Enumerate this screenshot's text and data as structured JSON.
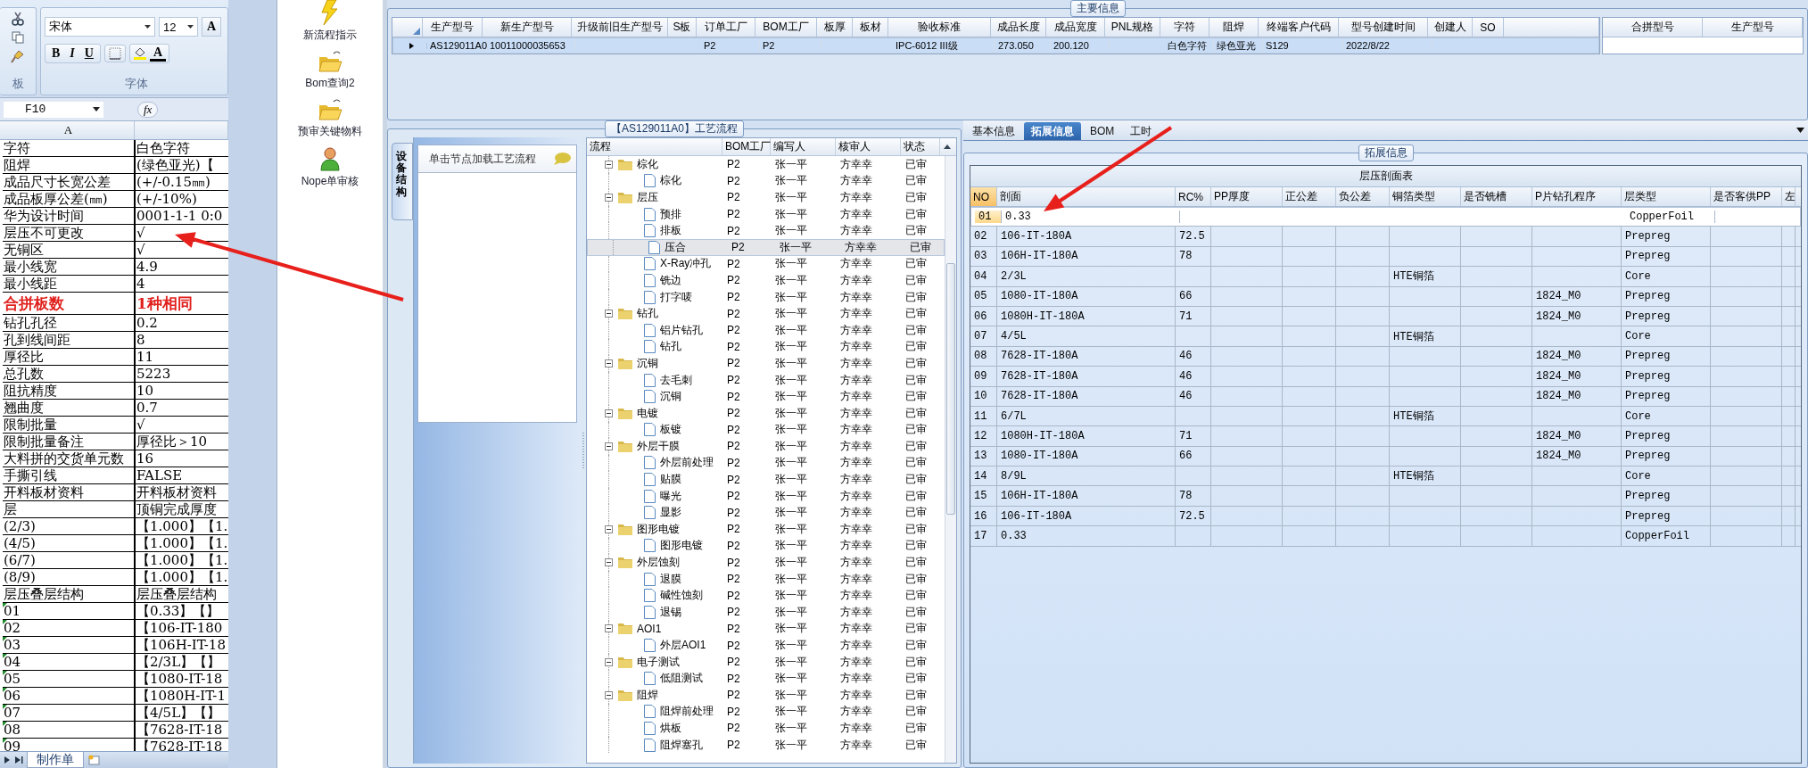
{
  "excel": {
    "clipboard_label": "板",
    "font_name": "宋体",
    "font_size": "12",
    "grow_font": "A",
    "format_buttons": [
      "B",
      "I",
      "U"
    ],
    "font_color": "A",
    "font_label": "字体",
    "name_box": "F10",
    "formula_label": "fx",
    "column_a": "A",
    "rows": [
      {
        "a": "字符",
        "b": "白色字符",
        "kind": "text"
      },
      {
        "a": "阻焊",
        "b": "(绿色亚光)【",
        "kind": "text"
      },
      {
        "a": "成品尺寸长宽公差",
        "b": "(+/-0.15㎜)",
        "kind": "text"
      },
      {
        "a": "成品板厚公差(㎜)",
        "b": "(+/-10%)",
        "kind": "text"
      },
      {
        "a": "华为设计时间",
        "b": "0001-1-1 0:0",
        "kind": "text"
      },
      {
        "a": "层压不可更改",
        "b": "√",
        "kind": "text"
      },
      {
        "a": "无铜区",
        "b": "√",
        "kind": "text"
      },
      {
        "a": "最小线宽",
        "b": "4.9",
        "kind": "text"
      },
      {
        "a": "最小线距",
        "b": "4",
        "kind": "text"
      },
      {
        "a": "合拼板数",
        "b": "1种相同",
        "kind": "highlight"
      },
      {
        "a": "钻孔孔径",
        "b": "0.2",
        "kind": "text"
      },
      {
        "a": "孔到线间距",
        "b": "8",
        "kind": "text"
      },
      {
        "a": "厚径比",
        "b": "11",
        "kind": "text"
      },
      {
        "a": "总孔数",
        "b": "5223",
        "kind": "text"
      },
      {
        "a": "阻抗精度",
        "b": "10",
        "kind": "text"
      },
      {
        "a": "翘曲度",
        "b": "0.7",
        "kind": "text"
      },
      {
        "a": "限制批量",
        "b": "√",
        "kind": "text"
      },
      {
        "a": "限制批量备注",
        "b": "厚径比＞10",
        "kind": "text"
      },
      {
        "a": "大料拼的交货单元数",
        "b": "16",
        "kind": "text"
      },
      {
        "a": "手撕引线",
        "b": "FALSE",
        "kind": "text"
      },
      {
        "a": "开料板材资料",
        "b": "开料板材资料",
        "kind": "text"
      },
      {
        "a": "层",
        "b": "顶铜完成厚度",
        "kind": "text"
      },
      {
        "a": "(2/3)",
        "b": "【1.000】【1.",
        "kind": "text"
      },
      {
        "a": "(4/5)",
        "b": "【1.000】【1.",
        "kind": "text"
      },
      {
        "a": "(6/7)",
        "b": "【1.000】【1.",
        "kind": "text"
      },
      {
        "a": "(8/9)",
        "b": "【1.000】【1.",
        "kind": "text"
      },
      {
        "a": "层压叠层结构",
        "b": "层压叠层结构",
        "kind": "text"
      },
      {
        "a": "01",
        "b": "【0.33】【】",
        "kind": "flagged"
      },
      {
        "a": "02",
        "b": "【106-IT-180",
        "kind": "flagged"
      },
      {
        "a": "03",
        "b": "【106H-IT-18",
        "kind": "flagged"
      },
      {
        "a": "04",
        "b": "【2/3L】【】",
        "kind": "flagged"
      },
      {
        "a": "05",
        "b": "【1080-IT-18",
        "kind": "flagged"
      },
      {
        "a": "06",
        "b": "【1080H-IT-1",
        "kind": "flagged"
      },
      {
        "a": "07",
        "b": "【4/5L】【】",
        "kind": "flagged"
      },
      {
        "a": "08",
        "b": "【7628-IT-18",
        "kind": "flagged"
      },
      {
        "a": "09",
        "b": "【7628-IT-18",
        "kind": "flagged"
      }
    ],
    "sheet_tab": "制作单"
  },
  "launcher": [
    "新流程指示",
    "Bom查询2",
    "预审关键物料",
    "Nope单审核"
  ],
  "main_info": {
    "title": "主要信息",
    "columns": [
      "生产型号",
      "新生产型号",
      "升级前旧生产型号",
      "S板",
      "订单工厂",
      "BOM工厂",
      "板厚",
      "板材",
      "验收标准",
      "成品长度",
      "成品宽度",
      "PNL规格",
      "字符",
      "阻焊",
      "终端客户代码",
      "型号创建时间",
      "创建人",
      "SO"
    ],
    "rows": [
      {
        "cells": [
          "AS129011A0",
          "10011000035653",
          null,
          null,
          "P2",
          "P2",
          null,
          null,
          "IPC-6012 III级",
          "273.050",
          "200.120",
          null,
          "白色字符",
          "绿色亚光",
          "S129",
          "2022/8/22",
          null,
          null
        ],
        "selected": true
      }
    ],
    "side_columns": [
      "合拼型号",
      "生产型号"
    ]
  },
  "process": {
    "title": "【AS129011A0】工艺流程",
    "side_tab": "设备结构",
    "hint": "单击节点加载工艺流程",
    "columns": [
      "流程",
      "BOM工厂",
      "编写人",
      "核审人",
      "状态"
    ],
    "tree": [
      {
        "name": "棕化",
        "bom": "P2",
        "writer": "张一平",
        "reviewer": "方幸幸",
        "status": "已审",
        "expanded": true,
        "selected": false,
        "children": [
          {
            "name": "棕化",
            "bom": "P2",
            "writer": "张一平",
            "reviewer": "方幸幸",
            "status": "已审",
            "selected": false
          }
        ]
      },
      {
        "name": "层压",
        "bom": "P2",
        "writer": "张一平",
        "reviewer": "方幸幸",
        "status": "已审",
        "expanded": true,
        "selected": false,
        "children": [
          {
            "name": "预排",
            "bom": "P2",
            "writer": "张一平",
            "reviewer": "方幸幸",
            "status": "已审",
            "selected": false
          },
          {
            "name": "排板",
            "bom": "P2",
            "writer": "张一平",
            "reviewer": "方幸幸",
            "status": "已审",
            "selected": false
          },
          {
            "name": "压合",
            "bom": "P2",
            "writer": "张一平",
            "reviewer": "方幸幸",
            "status": "已审",
            "selected": true
          },
          {
            "name": "X-Ray冲孔",
            "bom": "P2",
            "writer": "张一平",
            "reviewer": "方幸幸",
            "status": "已审",
            "selected": false
          },
          {
            "name": "铣边",
            "bom": "P2",
            "writer": "张一平",
            "reviewer": "方幸幸",
            "status": "已审",
            "selected": false
          },
          {
            "name": "打字唛",
            "bom": "P2",
            "writer": "张一平",
            "reviewer": "方幸幸",
            "status": "已审",
            "selected": false
          }
        ]
      },
      {
        "name": "钻孔",
        "bom": "P2",
        "writer": "张一平",
        "reviewer": "方幸幸",
        "status": "已审",
        "expanded": true,
        "selected": false,
        "children": [
          {
            "name": "铝片钻孔",
            "bom": "P2",
            "writer": "张一平",
            "reviewer": "方幸幸",
            "status": "已审",
            "selected": false
          },
          {
            "name": "钻孔",
            "bom": "P2",
            "writer": "张一平",
            "reviewer": "方幸幸",
            "status": "已审",
            "selected": false
          }
        ]
      },
      {
        "name": "沉铜",
        "bom": "P2",
        "writer": "张一平",
        "reviewer": "方幸幸",
        "status": "已审",
        "expanded": true,
        "selected": false,
        "children": [
          {
            "name": "去毛刺",
            "bom": "P2",
            "writer": "张一平",
            "reviewer": "方幸幸",
            "status": "已审",
            "selected": false
          },
          {
            "name": "沉铜",
            "bom": "P2",
            "writer": "张一平",
            "reviewer": "方幸幸",
            "status": "已审",
            "selected": false
          }
        ]
      },
      {
        "name": "电镀",
        "bom": "P2",
        "writer": "张一平",
        "reviewer": "方幸幸",
        "status": "已审",
        "expanded": true,
        "selected": false,
        "children": [
          {
            "name": "板镀",
            "bom": "P2",
            "writer": "张一平",
            "reviewer": "方幸幸",
            "status": "已审",
            "selected": false
          }
        ]
      },
      {
        "name": "外层干膜",
        "bom": "P2",
        "writer": "张一平",
        "reviewer": "方幸幸",
        "status": "已审",
        "expanded": true,
        "selected": false,
        "children": [
          {
            "name": "外层前处理",
            "bom": "P2",
            "writer": "张一平",
            "reviewer": "方幸幸",
            "status": "已审",
            "selected": false
          },
          {
            "name": "贴膜",
            "bom": "P2",
            "writer": "张一平",
            "reviewer": "方幸幸",
            "status": "已审",
            "selected": false
          },
          {
            "name": "曝光",
            "bom": "P2",
            "writer": "张一平",
            "reviewer": "方幸幸",
            "status": "已审",
            "selected": false
          },
          {
            "name": "显影",
            "bom": "P2",
            "writer": "张一平",
            "reviewer": "方幸幸",
            "status": "已审",
            "selected": false
          }
        ]
      },
      {
        "name": "图形电镀",
        "bom": "P2",
        "writer": "张一平",
        "reviewer": "方幸幸",
        "status": "已审",
        "expanded": true,
        "selected": false,
        "children": [
          {
            "name": "图形电镀",
            "bom": "P2",
            "writer": "张一平",
            "reviewer": "方幸幸",
            "status": "已审",
            "selected": false
          }
        ]
      },
      {
        "name": "外层蚀刻",
        "bom": "P2",
        "writer": "张一平",
        "reviewer": "方幸幸",
        "status": "已审",
        "expanded": true,
        "selected": false,
        "children": [
          {
            "name": "退膜",
            "bom": "P2",
            "writer": "张一平",
            "reviewer": "方幸幸",
            "status": "已审",
            "selected": false
          },
          {
            "name": "碱性蚀刻",
            "bom": "P2",
            "writer": "张一平",
            "reviewer": "方幸幸",
            "status": "已审",
            "selected": false
          },
          {
            "name": "退锡",
            "bom": "P2",
            "writer": "张一平",
            "reviewer": "方幸幸",
            "status": "已审",
            "selected": false
          }
        ]
      },
      {
        "name": "AOI1",
        "bom": "P2",
        "writer": "张一平",
        "reviewer": "方幸幸",
        "status": "已审",
        "expanded": true,
        "selected": false,
        "children": [
          {
            "name": "外层AOI1",
            "bom": "P2",
            "writer": "张一平",
            "reviewer": "方幸幸",
            "status": "已审",
            "selected": false
          }
        ]
      },
      {
        "name": "电子测试",
        "bom": "P2",
        "writer": "张一平",
        "reviewer": "方幸幸",
        "status": "已审",
        "expanded": true,
        "selected": false,
        "children": [
          {
            "name": "低阻测试",
            "bom": "P2",
            "writer": "张一平",
            "reviewer": "方幸幸",
            "status": "已审",
            "selected": false
          }
        ]
      },
      {
        "name": "阻焊",
        "bom": "P2",
        "writer": "张一平",
        "reviewer": "方幸幸",
        "status": "已审",
        "expanded": true,
        "selected": false,
        "children": [
          {
            "name": "阻焊前处理",
            "bom": "P2",
            "writer": "张一平",
            "reviewer": "方幸幸",
            "status": "已审",
            "selected": false
          },
          {
            "name": "烘板",
            "bom": "P2",
            "writer": "张一平",
            "reviewer": "方幸幸",
            "status": "已审",
            "selected": false
          },
          {
            "name": "阻焊塞孔",
            "bom": "P2",
            "writer": "张一平",
            "reviewer": "方幸幸",
            "status": "已审",
            "selected": false
          }
        ]
      }
    ]
  },
  "detail": {
    "tabs": [
      {
        "label": "基本信息",
        "selected": false
      },
      {
        "label": "拓展信息",
        "selected": true
      },
      {
        "label": "BOM",
        "selected": false
      },
      {
        "label": "工时",
        "selected": false
      }
    ],
    "group_title": "拓展信息",
    "table": {
      "title": "层压剖面表",
      "columns": [
        "NO",
        "剖面",
        "RC%",
        "PP厚度",
        "正公差",
        "负公差",
        "铜箔类型",
        "是否铣槽",
        "P片钻孔程序",
        "层类型",
        "是否客供PP",
        "左"
      ],
      "rows": [
        {
          "cells": [
            "01",
            "0.33",
            null,
            null,
            null,
            null,
            null,
            null,
            null,
            "CopperFoil",
            null,
            null
          ],
          "selected": true
        },
        {
          "cells": [
            "02",
            "106-IT-180A",
            "72.5",
            null,
            null,
            null,
            null,
            null,
            null,
            "Prepreg",
            null,
            null
          ],
          "selected": false
        },
        {
          "cells": [
            "03",
            "106H-IT-180A",
            "78",
            null,
            null,
            null,
            null,
            null,
            null,
            "Prepreg",
            null,
            null
          ],
          "selected": false
        },
        {
          "cells": [
            "04",
            "2/3L",
            null,
            null,
            null,
            null,
            "HTE铜箔",
            null,
            null,
            "Core",
            null,
            null
          ],
          "selected": false
        },
        {
          "cells": [
            "05",
            "1080-IT-180A",
            "66",
            null,
            null,
            null,
            null,
            null,
            "1824_M0",
            "Prepreg",
            null,
            null
          ],
          "selected": false
        },
        {
          "cells": [
            "06",
            "1080H-IT-180A",
            "71",
            null,
            null,
            null,
            null,
            null,
            "1824_M0",
            "Prepreg",
            null,
            null
          ],
          "selected": false
        },
        {
          "cells": [
            "07",
            "4/5L",
            null,
            null,
            null,
            null,
            "HTE铜箔",
            null,
            null,
            "Core",
            null,
            null
          ],
          "selected": false
        },
        {
          "cells": [
            "08",
            "7628-IT-180A",
            "46",
            null,
            null,
            null,
            null,
            null,
            "1824_M0",
            "Prepreg",
            null,
            null
          ],
          "selected": false
        },
        {
          "cells": [
            "09",
            "7628-IT-180A",
            "46",
            null,
            null,
            null,
            null,
            null,
            "1824_M0",
            "Prepreg",
            null,
            null
          ],
          "selected": false
        },
        {
          "cells": [
            "10",
            "7628-IT-180A",
            "46",
            null,
            null,
            null,
            null,
            null,
            "1824_M0",
            "Prepreg",
            null,
            null
          ],
          "selected": false
        },
        {
          "cells": [
            "11",
            "6/7L",
            null,
            null,
            null,
            null,
            "HTE铜箔",
            null,
            null,
            "Core",
            null,
            null
          ],
          "selected": false
        },
        {
          "cells": [
            "12",
            "1080H-IT-180A",
            "71",
            null,
            null,
            null,
            null,
            null,
            "1824_M0",
            "Prepreg",
            null,
            null
          ],
          "selected": false
        },
        {
          "cells": [
            "13",
            "1080-IT-180A",
            "66",
            null,
            null,
            null,
            null,
            null,
            "1824_M0",
            "Prepreg",
            null,
            null
          ],
          "selected": false
        },
        {
          "cells": [
            "14",
            "8/9L",
            null,
            null,
            null,
            null,
            "HTE铜箔",
            null,
            null,
            "Core",
            null,
            null
          ],
          "selected": false
        },
        {
          "cells": [
            "15",
            "106H-IT-180A",
            "78",
            null,
            null,
            null,
            null,
            null,
            null,
            "Prepreg",
            null,
            null
          ],
          "selected": false
        },
        {
          "cells": [
            "16",
            "106-IT-180A",
            "72.5",
            null,
            null,
            null,
            null,
            null,
            null,
            "Prepreg",
            null,
            null
          ],
          "selected": false
        },
        {
          "cells": [
            "17",
            "0.33",
            null,
            null,
            null,
            null,
            null,
            null,
            null,
            "CopperFoil",
            null,
            null
          ],
          "selected": false
        }
      ]
    }
  }
}
